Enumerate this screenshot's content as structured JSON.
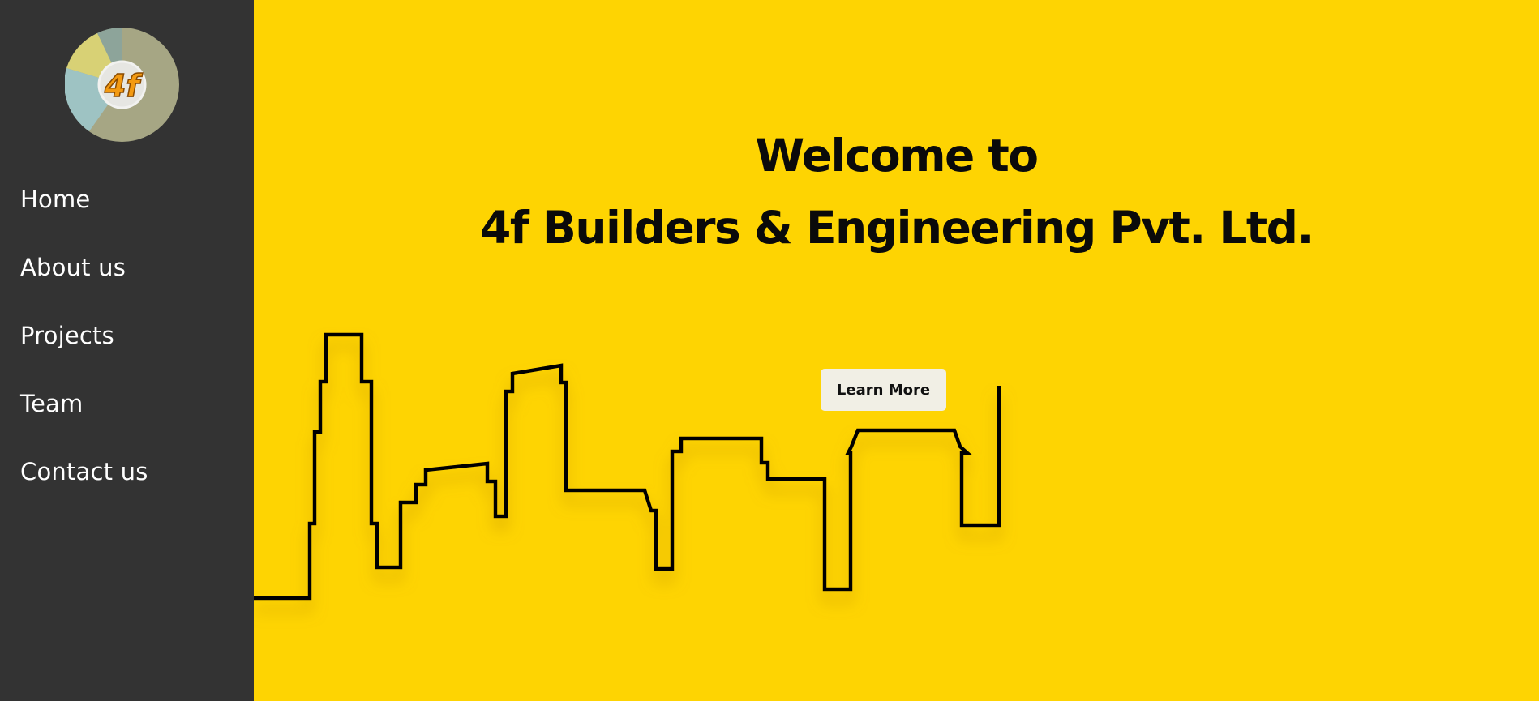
{
  "logo": {
    "text": "4f",
    "ring_colors": [
      "#a6a684",
      "#9ec3c3",
      "#d8d175",
      "#8da49a"
    ],
    "letter_color": "#F39A12"
  },
  "sidebar": {
    "items": [
      {
        "label": "Home"
      },
      {
        "label": "About us"
      },
      {
        "label": "Projects"
      },
      {
        "label": "Team"
      },
      {
        "label": "Contact us"
      }
    ],
    "background": "#333333"
  },
  "hero": {
    "line1": "Welcome to",
    "line2": "4f Builders & Engineering Pvt. Ltd.",
    "button_label": "Learn More",
    "background": "#FED402"
  }
}
